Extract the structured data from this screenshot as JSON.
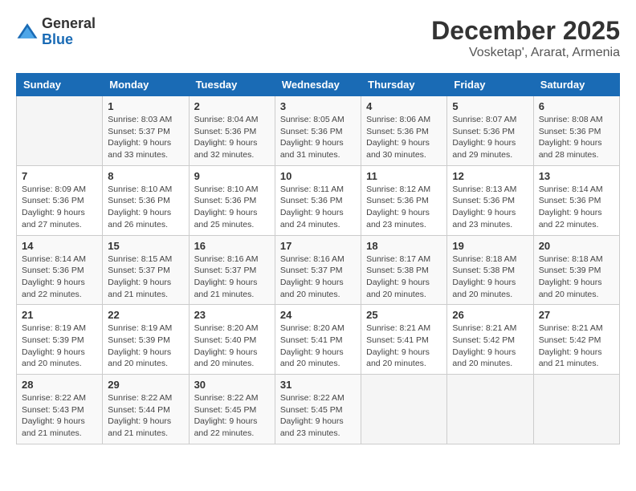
{
  "logo": {
    "general": "General",
    "blue": "Blue"
  },
  "title": "December 2025",
  "subtitle": "Vosketap', Ararat, Armenia",
  "weekdays": [
    "Sunday",
    "Monday",
    "Tuesday",
    "Wednesday",
    "Thursday",
    "Friday",
    "Saturday"
  ],
  "weeks": [
    [
      {
        "num": "",
        "info": ""
      },
      {
        "num": "1",
        "info": "Sunrise: 8:03 AM\nSunset: 5:37 PM\nDaylight: 9 hours\nand 33 minutes."
      },
      {
        "num": "2",
        "info": "Sunrise: 8:04 AM\nSunset: 5:36 PM\nDaylight: 9 hours\nand 32 minutes."
      },
      {
        "num": "3",
        "info": "Sunrise: 8:05 AM\nSunset: 5:36 PM\nDaylight: 9 hours\nand 31 minutes."
      },
      {
        "num": "4",
        "info": "Sunrise: 8:06 AM\nSunset: 5:36 PM\nDaylight: 9 hours\nand 30 minutes."
      },
      {
        "num": "5",
        "info": "Sunrise: 8:07 AM\nSunset: 5:36 PM\nDaylight: 9 hours\nand 29 minutes."
      },
      {
        "num": "6",
        "info": "Sunrise: 8:08 AM\nSunset: 5:36 PM\nDaylight: 9 hours\nand 28 minutes."
      }
    ],
    [
      {
        "num": "7",
        "info": "Sunrise: 8:09 AM\nSunset: 5:36 PM\nDaylight: 9 hours\nand 27 minutes."
      },
      {
        "num": "8",
        "info": "Sunrise: 8:10 AM\nSunset: 5:36 PM\nDaylight: 9 hours\nand 26 minutes."
      },
      {
        "num": "9",
        "info": "Sunrise: 8:10 AM\nSunset: 5:36 PM\nDaylight: 9 hours\nand 25 minutes."
      },
      {
        "num": "10",
        "info": "Sunrise: 8:11 AM\nSunset: 5:36 PM\nDaylight: 9 hours\nand 24 minutes."
      },
      {
        "num": "11",
        "info": "Sunrise: 8:12 AM\nSunset: 5:36 PM\nDaylight: 9 hours\nand 23 minutes."
      },
      {
        "num": "12",
        "info": "Sunrise: 8:13 AM\nSunset: 5:36 PM\nDaylight: 9 hours\nand 23 minutes."
      },
      {
        "num": "13",
        "info": "Sunrise: 8:14 AM\nSunset: 5:36 PM\nDaylight: 9 hours\nand 22 minutes."
      }
    ],
    [
      {
        "num": "14",
        "info": "Sunrise: 8:14 AM\nSunset: 5:36 PM\nDaylight: 9 hours\nand 22 minutes."
      },
      {
        "num": "15",
        "info": "Sunrise: 8:15 AM\nSunset: 5:37 PM\nDaylight: 9 hours\nand 21 minutes."
      },
      {
        "num": "16",
        "info": "Sunrise: 8:16 AM\nSunset: 5:37 PM\nDaylight: 9 hours\nand 21 minutes."
      },
      {
        "num": "17",
        "info": "Sunrise: 8:16 AM\nSunset: 5:37 PM\nDaylight: 9 hours\nand 20 minutes."
      },
      {
        "num": "18",
        "info": "Sunrise: 8:17 AM\nSunset: 5:38 PM\nDaylight: 9 hours\nand 20 minutes."
      },
      {
        "num": "19",
        "info": "Sunrise: 8:18 AM\nSunset: 5:38 PM\nDaylight: 9 hours\nand 20 minutes."
      },
      {
        "num": "20",
        "info": "Sunrise: 8:18 AM\nSunset: 5:39 PM\nDaylight: 9 hours\nand 20 minutes."
      }
    ],
    [
      {
        "num": "21",
        "info": "Sunrise: 8:19 AM\nSunset: 5:39 PM\nDaylight: 9 hours\nand 20 minutes."
      },
      {
        "num": "22",
        "info": "Sunrise: 8:19 AM\nSunset: 5:39 PM\nDaylight: 9 hours\nand 20 minutes."
      },
      {
        "num": "23",
        "info": "Sunrise: 8:20 AM\nSunset: 5:40 PM\nDaylight: 9 hours\nand 20 minutes."
      },
      {
        "num": "24",
        "info": "Sunrise: 8:20 AM\nSunset: 5:41 PM\nDaylight: 9 hours\nand 20 minutes."
      },
      {
        "num": "25",
        "info": "Sunrise: 8:21 AM\nSunset: 5:41 PM\nDaylight: 9 hours\nand 20 minutes."
      },
      {
        "num": "26",
        "info": "Sunrise: 8:21 AM\nSunset: 5:42 PM\nDaylight: 9 hours\nand 20 minutes."
      },
      {
        "num": "27",
        "info": "Sunrise: 8:21 AM\nSunset: 5:42 PM\nDaylight: 9 hours\nand 21 minutes."
      }
    ],
    [
      {
        "num": "28",
        "info": "Sunrise: 8:22 AM\nSunset: 5:43 PM\nDaylight: 9 hours\nand 21 minutes."
      },
      {
        "num": "29",
        "info": "Sunrise: 8:22 AM\nSunset: 5:44 PM\nDaylight: 9 hours\nand 21 minutes."
      },
      {
        "num": "30",
        "info": "Sunrise: 8:22 AM\nSunset: 5:45 PM\nDaylight: 9 hours\nand 22 minutes."
      },
      {
        "num": "31",
        "info": "Sunrise: 8:22 AM\nSunset: 5:45 PM\nDaylight: 9 hours\nand 23 minutes."
      },
      {
        "num": "",
        "info": ""
      },
      {
        "num": "",
        "info": ""
      },
      {
        "num": "",
        "info": ""
      }
    ]
  ]
}
